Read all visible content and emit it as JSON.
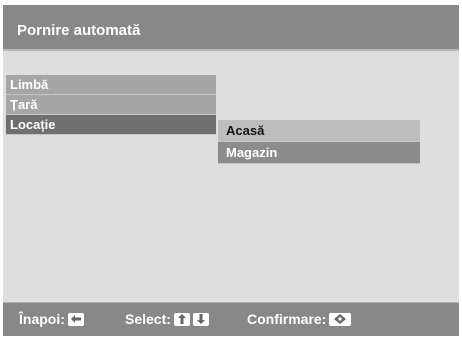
{
  "header": {
    "title": "Pornire automată"
  },
  "menu": {
    "items": [
      {
        "label": "Limbă"
      },
      {
        "label": "Țară"
      },
      {
        "label": "Locație"
      }
    ],
    "selected_index": 2
  },
  "submenu": {
    "items": [
      {
        "label": "Acasă"
      },
      {
        "label": "Magazin"
      }
    ],
    "highlighted_index": 0
  },
  "footer": {
    "back_label": "Înapoi:",
    "back_icon": "left-arrow-icon",
    "select_label": "Select:",
    "select_icons": [
      "up-arrow-icon",
      "down-arrow-icon"
    ],
    "confirm_label": "Confirmare:",
    "confirm_icon": "ok-diamond-icon"
  },
  "colors": {
    "title_bar": "#888888",
    "content_bg": "#dedede",
    "menu_item": "#a6a6a6",
    "menu_selected": "#6f6f6f",
    "sub_highlight": "#bdbdbd",
    "sub_normal": "#8c8c8c"
  }
}
